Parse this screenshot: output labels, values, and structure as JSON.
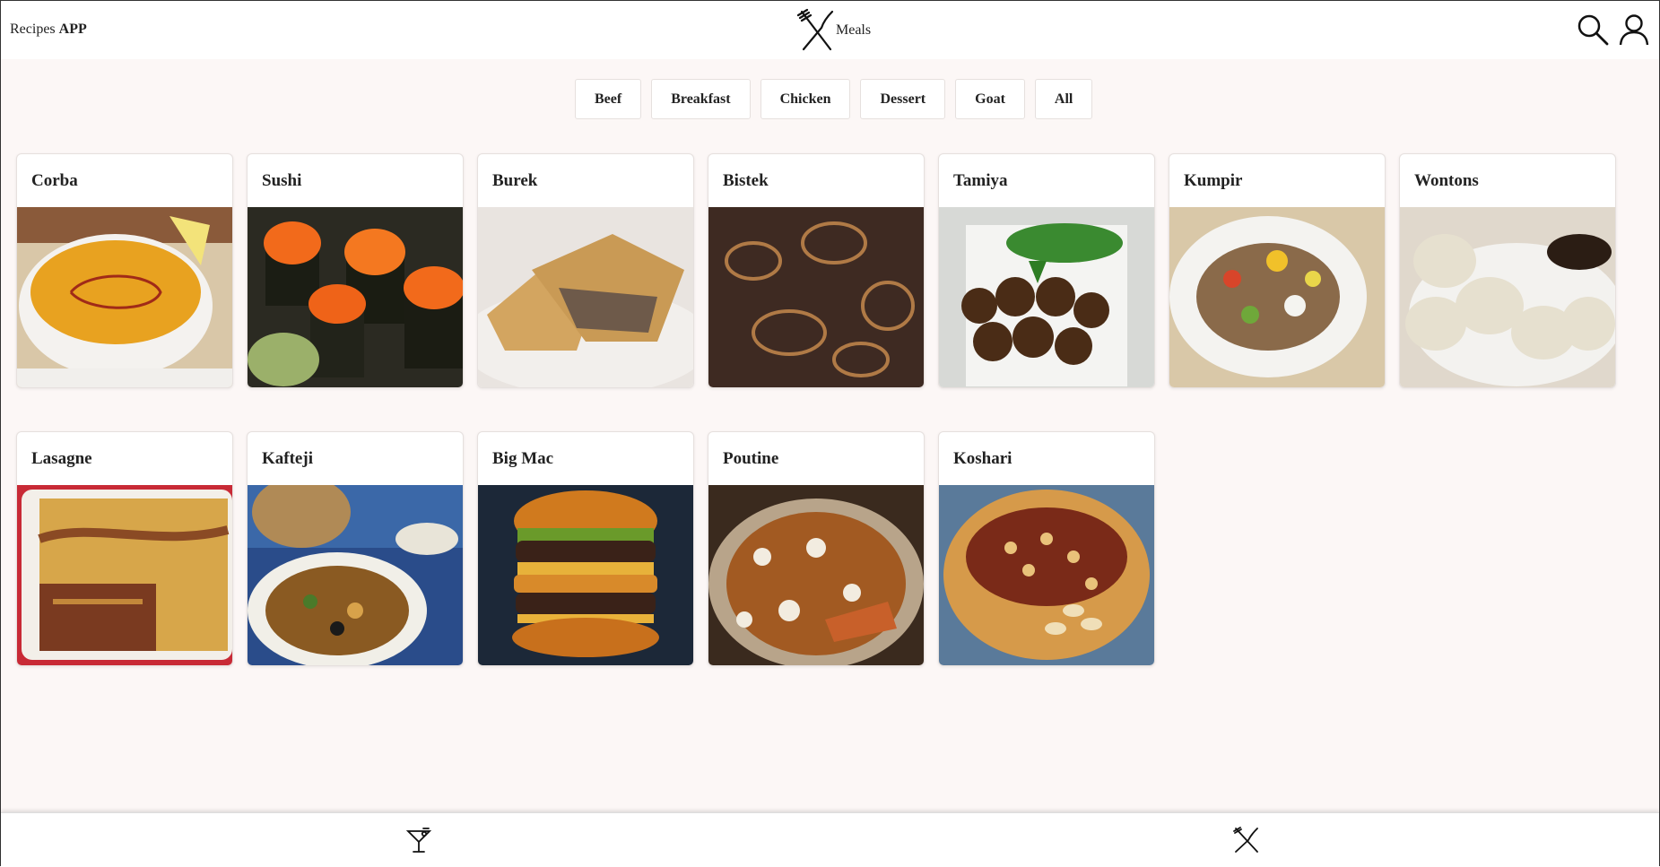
{
  "header": {
    "brand_prefix": "Recipes",
    "brand_bold": "APP",
    "section_title": "Meals",
    "section_icon": "fork-knife-icon",
    "search_icon": "search-icon",
    "profile_icon": "user-icon"
  },
  "filters": [
    "Beef",
    "Breakfast",
    "Chicken",
    "Dessert",
    "Goat",
    "All"
  ],
  "meals": [
    {
      "name": "Corba",
      "image": "lentil-soup"
    },
    {
      "name": "Sushi",
      "image": "sushi-rolls"
    },
    {
      "name": "Burek",
      "image": "pastry"
    },
    {
      "name": "Bistek",
      "image": "steak-onions"
    },
    {
      "name": "Tamiya",
      "image": "falafel"
    },
    {
      "name": "Kumpir",
      "image": "baked-potato"
    },
    {
      "name": "Wontons",
      "image": "dumplings"
    },
    {
      "name": "Lasagne",
      "image": "lasagne"
    },
    {
      "name": "Kafteji",
      "image": "kafteji"
    },
    {
      "name": "Big Mac",
      "image": "burger"
    },
    {
      "name": "Poutine",
      "image": "poutine"
    },
    {
      "name": "Koshari",
      "image": "koshari"
    }
  ],
  "bottom_nav": {
    "drinks_icon": "cocktail-glass-icon",
    "meals_icon": "fork-knife-icon"
  }
}
